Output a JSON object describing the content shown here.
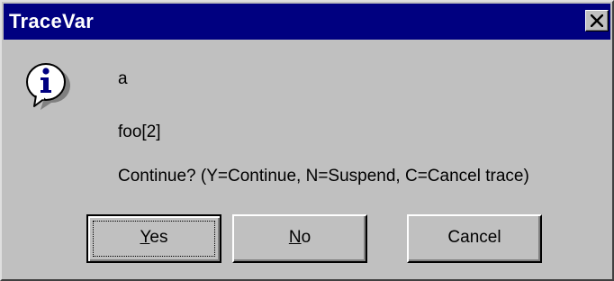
{
  "window": {
    "title": "TraceVar",
    "close_icon": "close-icon"
  },
  "icon": {
    "name": "information-icon",
    "glyph": "i",
    "color": "#000080"
  },
  "message": {
    "line1": "a",
    "line2": "foo[2]",
    "line3": "Continue?  (Y=Continue, N=Suspend, C=Cancel trace)"
  },
  "buttons": {
    "yes": {
      "mnemonic": "Y",
      "rest": "es"
    },
    "no": {
      "mnemonic": "N",
      "rest": "o"
    },
    "cancel": {
      "label": "Cancel"
    }
  },
  "colors": {
    "titlebar": "#000080",
    "face": "#c0c0c0"
  }
}
